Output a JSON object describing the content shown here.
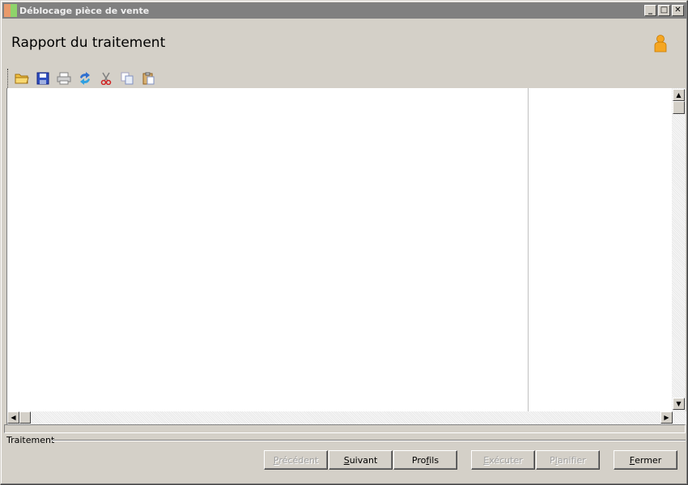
{
  "window": {
    "title": "Déblocage pièce de vente"
  },
  "header": {
    "title": "Rapport du traitement"
  },
  "toolbar": {
    "icons": [
      "open-folder-icon",
      "save-icon",
      "print-icon",
      "refresh-icon",
      "cut-icon",
      "copy-icon",
      "paste-icon"
    ]
  },
  "status": {
    "group_label": "Traitement"
  },
  "buttons": {
    "precedent": {
      "accel": "P",
      "rest": "récédent"
    },
    "suivant": {
      "accel": "S",
      "rest": "uivant"
    },
    "profils": {
      "pre": "Pro",
      "accel": "f",
      "rest": "ils"
    },
    "executer": {
      "accel": "E",
      "rest": "xécuter"
    },
    "planifier": {
      "pre": "P",
      "accel": "l",
      "rest": "anifier"
    },
    "fermer": {
      "accel": "F",
      "rest": "ermer"
    }
  },
  "colors": {
    "titlebar": "#808080",
    "face": "#d4d0c8",
    "user_icon": "#f5a623"
  }
}
